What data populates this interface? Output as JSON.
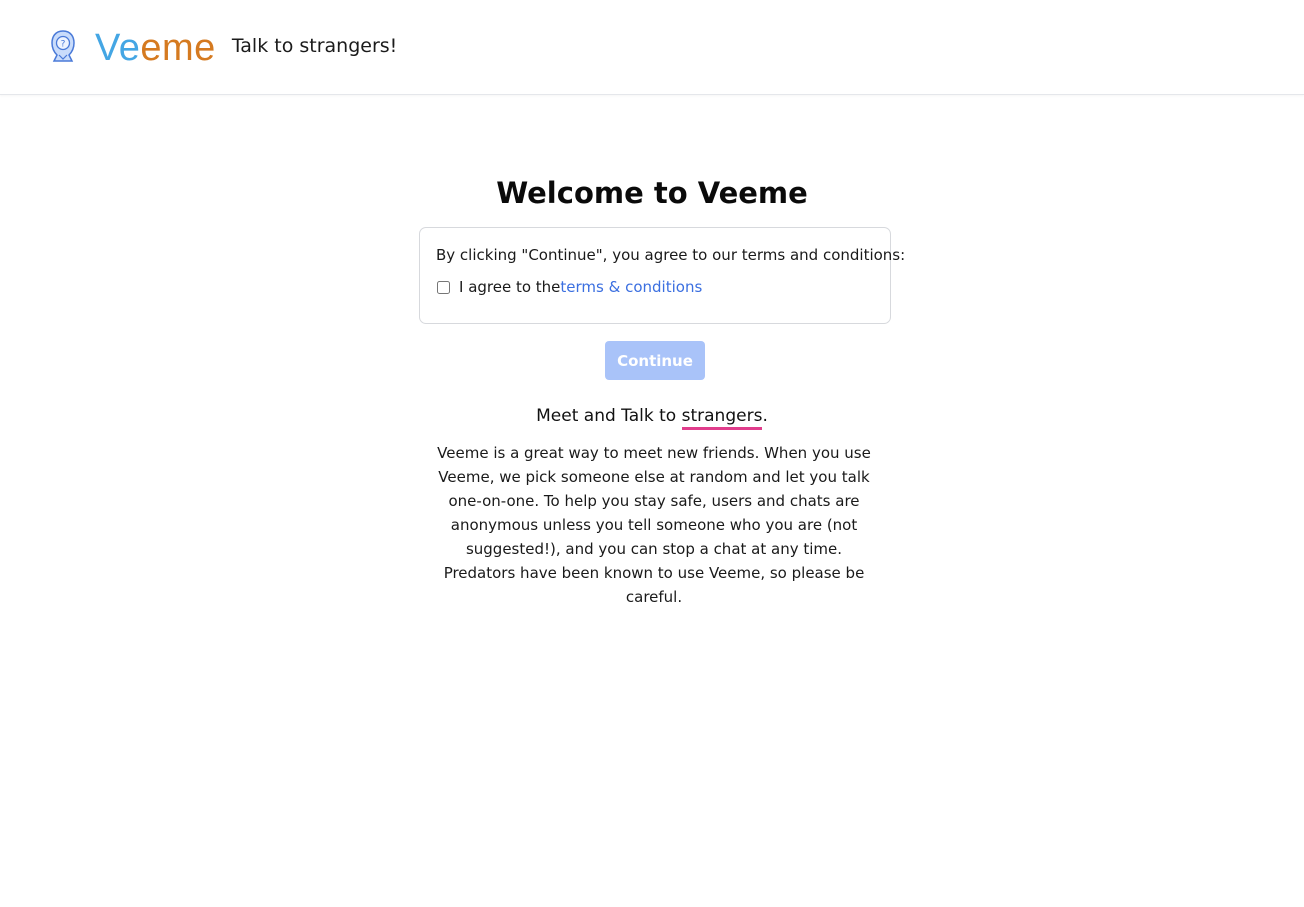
{
  "header": {
    "brand_part1": "Ve",
    "brand_part2": "eme",
    "tagline": "Talk to strangers!",
    "logo_icon": "hooded-stranger-icon",
    "colors": {
      "brand_blue": "#44a6e4",
      "brand_orange": "#d57a20"
    }
  },
  "main": {
    "title": "Welcome to Veeme",
    "terms": {
      "notice": "By clicking \"Continue\", you agree to our terms and conditions:",
      "checkbox_label": "I agree to the",
      "link_text": "terms & conditions",
      "checked": false
    },
    "continue_label": "Continue",
    "continue_disabled": true,
    "intro_prefix": "Meet and Talk to ",
    "intro_highlight": "strangers",
    "intro_suffix": ".",
    "description": "Veeme is a great way to meet new friends. When you use Veeme, we pick someone else at random and let you talk one-on-one. To help you stay safe, users and chats are anonymous unless you tell someone who you are (not suggested!), and you can stop a chat at any time. Predators have been known to use Veeme, so please be careful.",
    "colors": {
      "button_bg": "#a9c3f9",
      "link": "#3b6fe0",
      "underline": "#e13d8c"
    }
  }
}
